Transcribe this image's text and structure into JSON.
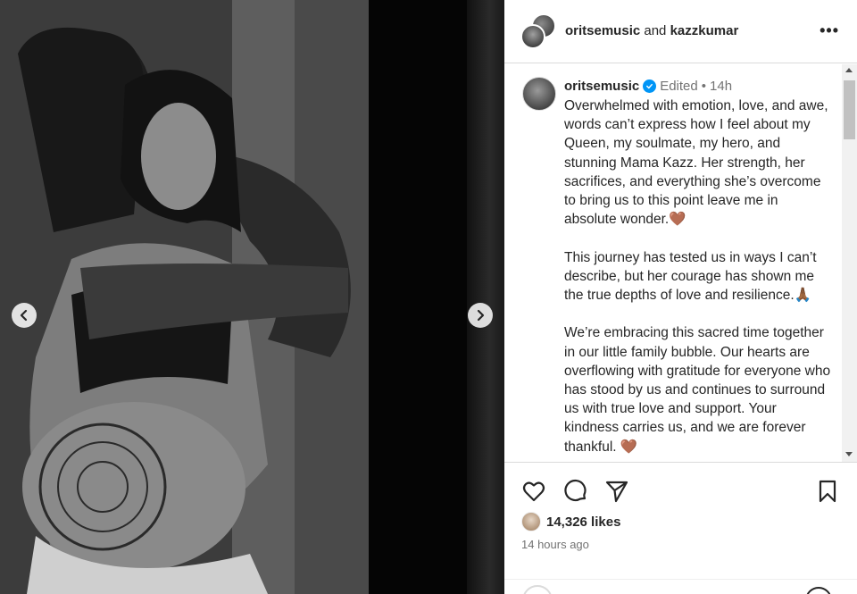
{
  "header": {
    "user1": "oritsemusic",
    "conjunction": "and",
    "user2": "kazzkumar",
    "more_label": "•••"
  },
  "caption": {
    "username": "oritsemusic",
    "edited": "Edited",
    "dot": "•",
    "time": "14h",
    "text": "Overwhelmed with emotion, love, and awe, words can’t express how I feel about my Queen, my soulmate, my hero, and stunning Mama Kazz. Her strength, her sacrifices, and everything she’s overcome to bring us to this point leave me in absolute wonder.🤎\n\nThis journey has tested us in ways I can’t describe, but her courage has shown me the true depths of love and resilience.🙏🏾\n\nWe’re embracing this sacred time together in our little family bubble. Our hearts are overflowing with gratitude for everyone who has stood by us and continues to surround us with true love and support. Your kindness carries us, and we are forever thankful. 🤎"
  },
  "engagement": {
    "likes": "14,326 likes",
    "time_ago": "14 hours ago"
  },
  "icons": {
    "like": "heart-icon",
    "comment": "comment-icon",
    "share": "share-icon",
    "save": "bookmark-icon",
    "verified": "verified-badge-icon",
    "prev": "chevron-left-icon",
    "next": "chevron-right-icon"
  },
  "colors": {
    "verified": "#0095f6",
    "text": "#262626",
    "muted": "#737373",
    "border": "#dbdbdb"
  }
}
